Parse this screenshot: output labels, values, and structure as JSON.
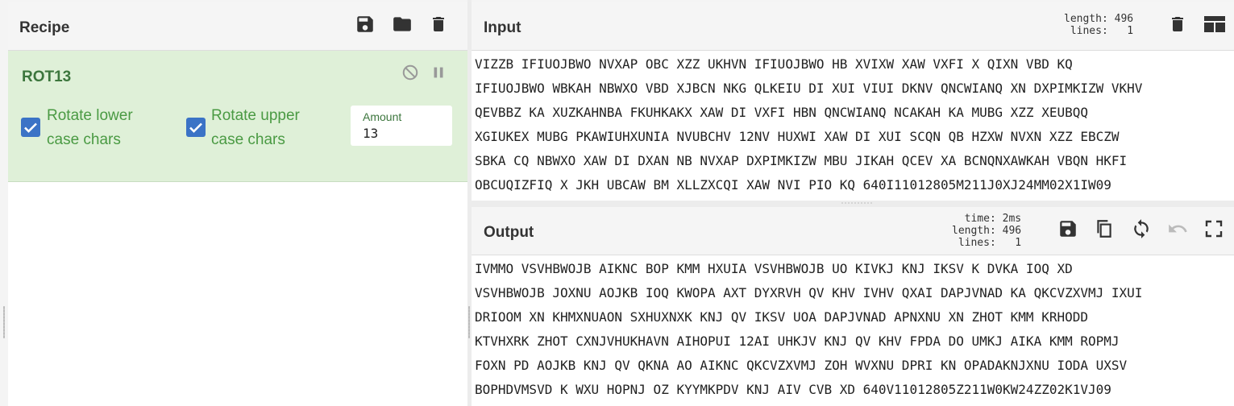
{
  "recipe": {
    "title": "Recipe",
    "icons": {
      "save": "save-icon",
      "open": "folder-icon",
      "clear": "trash-icon"
    },
    "operation": {
      "name": "ROT13",
      "disable_icon": "disable-icon",
      "pause_icon": "pause-icon",
      "options": [
        {
          "label_line1": "Rotate lower",
          "label_line2": "case chars",
          "checked": true
        },
        {
          "label_line1": "Rotate upper",
          "label_line2": "case chars",
          "checked": true
        }
      ],
      "amount": {
        "label": "Amount",
        "value": "13"
      }
    }
  },
  "input": {
    "title": "Input",
    "length_label": "length:",
    "length_value": "496",
    "lines_label": "lines:",
    "lines_value": "1",
    "lines": [
      "VIZZB IFIUOJBWO NVXAP OBC XZZ UKHVN IFIUOJBWO HB XVIXW XAW VXFI X QIXN VBD KQ",
      "IFIUOJBWO WBKAH NBWXO VBD XJBCN NKG QLKEIU DI XUI VIUI DKNV QNCWIANQ XN DXPIMKIZW VKHV",
      "QEVBBZ KA XUZKAHNBA FKUHKAKX XAW DI VXFI HBN QNCWIANQ NCAKAH KA MUBG XZZ XEUBQQ",
      "XGIUKEX MUBG PKAWIUHXUNIA NVUBCHV 12NV HUXWI XAW DI XUI SCQN QB HZXW NVXN XZZ EBCZW",
      "SBKA CQ NBWXO XAW DI DXAN NB NVXAP DXPIMKIZW MBU JIKAH QCEV XA BCNQNXAWKAH VBQN HKFI",
      "OBCUQIZFIQ X JKH UBCAW BM XLLZXCQI XAW NVI PIO KQ 640I11012805M211J0XJ24MM02X1IW09"
    ]
  },
  "output": {
    "title": "Output",
    "time_label": "time:",
    "time_value": "2ms",
    "length_label": "length:",
    "length_value": "496",
    "lines_label": "lines:",
    "lines_value": "1",
    "lines": [
      "IVMMO VSVHBWOJB AIKNC BOP KMM HXUIA VSVHBWOJB UO KIVKJ KNJ IKSV K DVKA IOQ XD",
      "VSVHBWOJB JOXNU AOJKB IOQ KWOPA AXT DYXRVH QV KHV IVHV QXAI DAPJVNAD KA QKCVZXVMJ IXUI",
      "DRIOOM XN KHMXNUAON SXHUXNXK KNJ QV IKSV UOA DAPJVNAD APNXNU XN ZHOT KMM KRHODD",
      "KTVHXRK ZHOT CXNJVHUKHAVN AIHOPUI 12AI UHKJV KNJ QV KHV FPDA DO UMKJ AIKA KMM ROPMJ",
      "FOXN PD AOJKB KNJ QV QKNA AO AIKNC QKCVZXVMJ ZOH WVXNU DPRI KN OPADAKNJXNU IODA UXSV",
      "BOPHDVMSVD K WXU HOPNJ OZ KYYMKPDV KNJ AIV CVB XD 640V11012805Z211W0KW24ZZ02K1VJ09"
    ]
  },
  "colors": {
    "op_bg": "#dff0d8",
    "op_title": "#3c763d",
    "label_green": "#4a9a43",
    "checkbox": "#3b73c6",
    "icon": "#333333",
    "icon_muted": "#999999"
  }
}
